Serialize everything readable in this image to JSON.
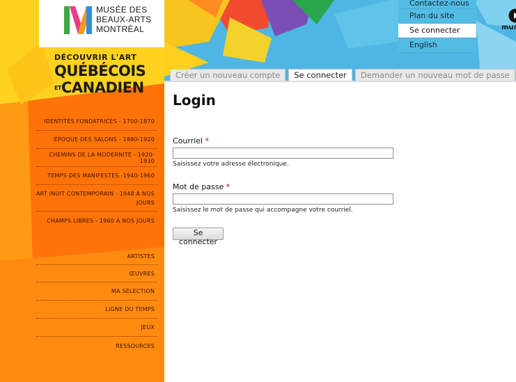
{
  "logo": {
    "line1": "MUSÉE DES",
    "line2": "BEAUX-ARTS",
    "line3": "MONTRÉAL"
  },
  "tagline": {
    "line1": "DÉCOUVRIR L'ART",
    "line2": "QUÉBÉCOIS",
    "et": "ET",
    "line3": "CANADIEN"
  },
  "nav_periods": [
    "Identités fondatrices - 1700-1870",
    "Époque des Salons - 1880-1920",
    "Chemins de la modernité - 1920-1930",
    "Temps des manifestes -1940-1960",
    "Art inuit contemporain - 1948 à nos jours",
    "Champs libres - 1960 à nos jours"
  ],
  "nav_tools": [
    "Artistes",
    "Œuvres",
    "Ma sélection",
    "Ligne du temps",
    "Jeux",
    "Ressources"
  ],
  "top_links": [
    {
      "label": "Contactez-nous",
      "active": false
    },
    {
      "label": "Plan du site",
      "active": false
    },
    {
      "label": "Se connecter",
      "active": true
    },
    {
      "label": "English",
      "active": false
    }
  ],
  "partner_text": "mus",
  "tabs": [
    {
      "label": "Créer un nouveau compte",
      "active": false
    },
    {
      "label": "Se connecter",
      "active": true
    },
    {
      "label": "Demander un nouveau mot de passe",
      "active": false
    }
  ],
  "form": {
    "title": "Login",
    "email_label": "Courriel",
    "email_value": "",
    "email_help": "Saisissez votre adresse électronique.",
    "password_label": "Mot de passe",
    "password_value": "",
    "password_help": "Saisissez le mot de passe qui accompagne votre courriel.",
    "required_mark": "*",
    "submit_label": "Se connecter"
  },
  "colors": {
    "sidebar_yellow": "#ffd21f",
    "sidebar_orange": "#ff7d0a",
    "sky_blue": "#4fb6e4",
    "required": "#c40000"
  }
}
